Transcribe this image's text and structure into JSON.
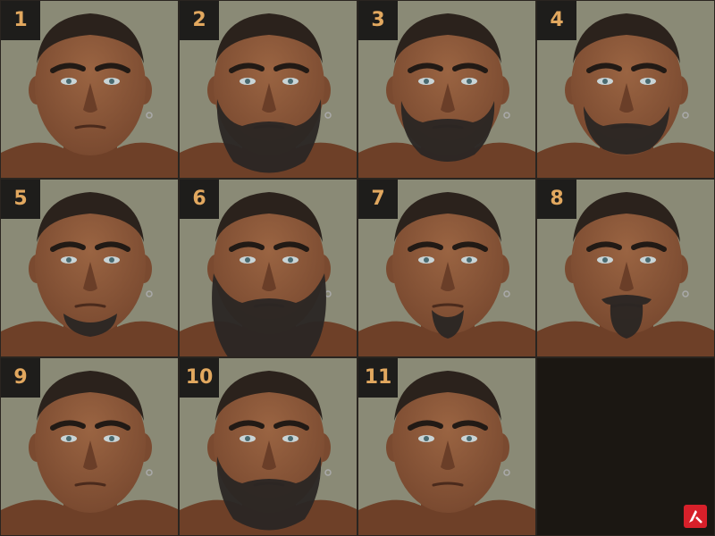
{
  "colors": {
    "background": "#8a8a76",
    "skin": "#7a4a30",
    "hair": "#2b221c",
    "beard": "#2a2624",
    "badge_bg": "#1e1d1b",
    "badge_text": "#e2a85f",
    "empty_tile": "#1b1712",
    "logo": "#d7202a"
  },
  "variants": [
    {
      "number": "1",
      "beard": "none"
    },
    {
      "number": "2",
      "beard": "full"
    },
    {
      "number": "3",
      "beard": "full-short"
    },
    {
      "number": "4",
      "beard": "short"
    },
    {
      "number": "5",
      "beard": "chin-stubble"
    },
    {
      "number": "6",
      "beard": "long"
    },
    {
      "number": "7",
      "beard": "goatee"
    },
    {
      "number": "8",
      "beard": "goatee-mustache"
    },
    {
      "number": "9",
      "beard": "none"
    },
    {
      "number": "10",
      "beard": "full"
    },
    {
      "number": "11",
      "beard": "none"
    }
  ],
  "logo_icon": "brand-logo-icon"
}
